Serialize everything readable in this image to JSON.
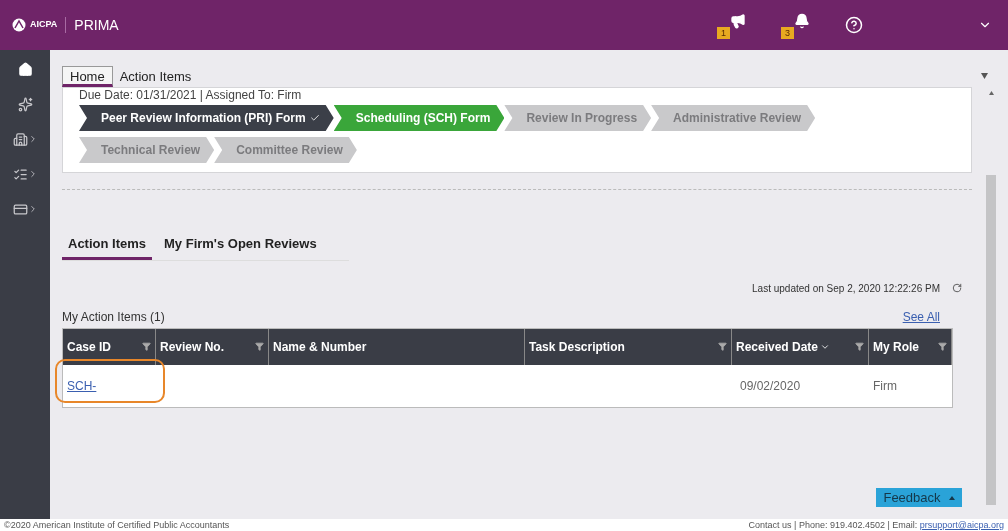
{
  "header": {
    "brand": "AICPA",
    "product": "PRIMA",
    "notifications": [
      {
        "kind": "announce",
        "count": "1"
      },
      {
        "kind": "bell",
        "count": "3"
      }
    ]
  },
  "sidebar": {
    "items": [
      {
        "kind": "home",
        "selected": true
      },
      {
        "kind": "spark",
        "selected": false
      },
      {
        "kind": "building",
        "selected": false
      },
      {
        "kind": "list",
        "selected": false
      },
      {
        "kind": "card",
        "selected": false
      }
    ]
  },
  "breadcrumb_tabs": [
    {
      "label": "Home",
      "selected": true
    },
    {
      "label": "Action Items",
      "selected": false
    }
  ],
  "case_summary": {
    "details": "Due Date: 01/31/2021 | Assigned To: Firm",
    "steps": [
      {
        "label": "Peer Review Information (PRI) Form",
        "kind": "done"
      },
      {
        "label": "Scheduling (SCH) Form",
        "kind": "current"
      },
      {
        "label": "Review In Progress",
        "kind": "pending"
      },
      {
        "label": "Administrative Review",
        "kind": "pending"
      },
      {
        "label": "Technical Review",
        "kind": "pending"
      },
      {
        "label": "Committee Review",
        "kind": "pending"
      }
    ]
  },
  "tabs": [
    {
      "label": "Action Items",
      "selected": true
    },
    {
      "label": "My Firm's Open Reviews",
      "selected": false
    }
  ],
  "last_updated": "Last updated on Sep 2, 2020 12:22:26 PM",
  "table": {
    "title": "My Action Items (1)",
    "see_all": "See All",
    "columns": [
      {
        "label": "Case ID",
        "filter": true
      },
      {
        "label": "Review No.",
        "filter": true
      },
      {
        "label": "Name & Number",
        "filter": false
      },
      {
        "label": "Task Description",
        "filter": true
      },
      {
        "label": "Received Date",
        "filter": true,
        "sorted": true
      },
      {
        "label": "My Role",
        "filter": true
      }
    ],
    "rows": [
      {
        "case_id": "SCH-",
        "review_no": "",
        "name": "",
        "task": "",
        "received": "09/02/2020",
        "role": "Firm",
        "annotated": true
      }
    ]
  },
  "feedback": "Feedback",
  "footer": {
    "copyright": "©2020 American Institute of Certified Public Accountants",
    "contact": "Contact us | Phone: 919.402.4502 | Email: ",
    "email": "prsupport@aicpa.org"
  }
}
